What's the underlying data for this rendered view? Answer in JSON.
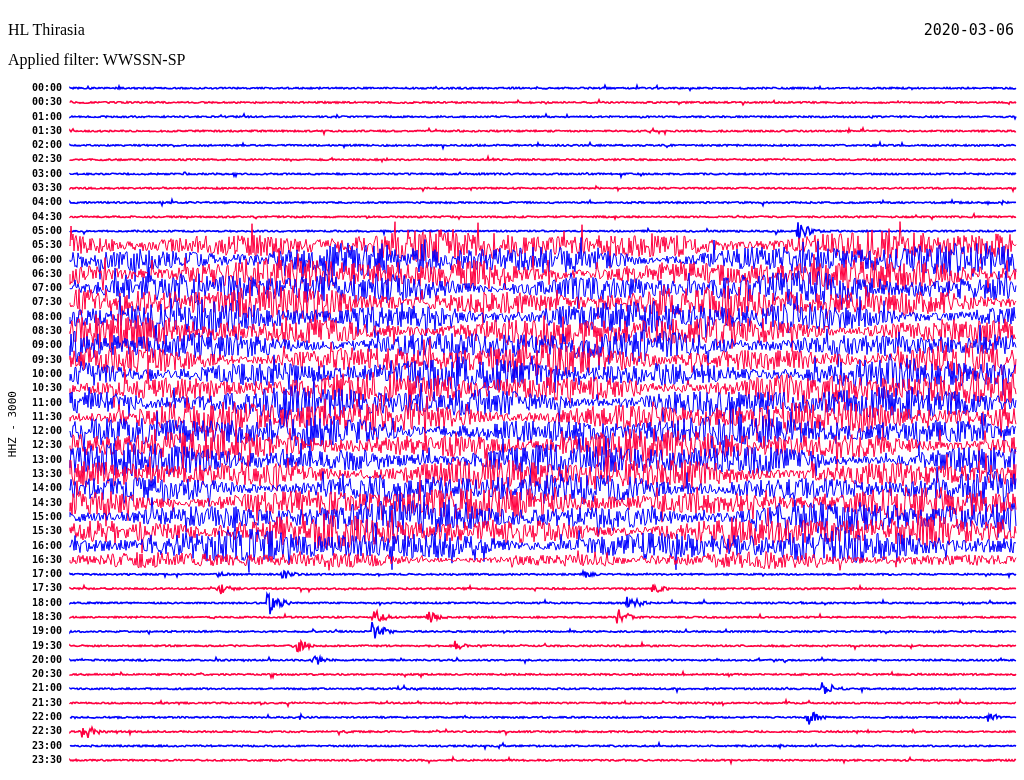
{
  "header": {
    "station": "HL Thirasia",
    "date": "2020-03-06",
    "filter": "Applied filter: WWSSN-SP"
  },
  "axis_label": "HHZ - 3000",
  "rows": [
    {
      "label": "00:00",
      "color": "#0000ff"
    },
    {
      "label": "00:30",
      "color": "#ff0040"
    },
    {
      "label": "01:00",
      "color": "#0000ff"
    },
    {
      "label": "01:30",
      "color": "#ff0040"
    },
    {
      "label": "02:00",
      "color": "#0000ff"
    },
    {
      "label": "02:30",
      "color": "#ff0040"
    },
    {
      "label": "03:00",
      "color": "#0000ff"
    },
    {
      "label": "03:30",
      "color": "#ff0040"
    },
    {
      "label": "04:00",
      "color": "#0000ff"
    },
    {
      "label": "04:30",
      "color": "#ff0040"
    },
    {
      "label": "05:00",
      "color": "#0000ff"
    },
    {
      "label": "05:30",
      "color": "#ff0040"
    },
    {
      "label": "06:00",
      "color": "#0000ff"
    },
    {
      "label": "06:30",
      "color": "#ff0040"
    },
    {
      "label": "07:00",
      "color": "#0000ff"
    },
    {
      "label": "07:30",
      "color": "#ff0040"
    },
    {
      "label": "08:00",
      "color": "#0000ff"
    },
    {
      "label": "08:30",
      "color": "#ff0040"
    },
    {
      "label": "09:00",
      "color": "#0000ff"
    },
    {
      "label": "09:30",
      "color": "#ff0040"
    },
    {
      "label": "10:00",
      "color": "#0000ff"
    },
    {
      "label": "10:30",
      "color": "#ff0040"
    },
    {
      "label": "11:00",
      "color": "#0000ff"
    },
    {
      "label": "11:30",
      "color": "#ff0040"
    },
    {
      "label": "12:00",
      "color": "#0000ff"
    },
    {
      "label": "12:30",
      "color": "#ff0040"
    },
    {
      "label": "13:00",
      "color": "#0000ff"
    },
    {
      "label": "13:30",
      "color": "#ff0040"
    },
    {
      "label": "14:00",
      "color": "#0000ff"
    },
    {
      "label": "14:30",
      "color": "#ff0040"
    },
    {
      "label": "15:00",
      "color": "#0000ff"
    },
    {
      "label": "15:30",
      "color": "#ff0040"
    },
    {
      "label": "16:00",
      "color": "#0000ff"
    },
    {
      "label": "16:30",
      "color": "#ff0040"
    },
    {
      "label": "17:00",
      "color": "#0000ff"
    },
    {
      "label": "17:30",
      "color": "#ff0040"
    },
    {
      "label": "18:00",
      "color": "#0000ff"
    },
    {
      "label": "18:30",
      "color": "#ff0040"
    },
    {
      "label": "19:00",
      "color": "#0000ff"
    },
    {
      "label": "19:30",
      "color": "#ff0040"
    },
    {
      "label": "20:00",
      "color": "#0000ff"
    },
    {
      "label": "20:30",
      "color": "#ff0040"
    },
    {
      "label": "21:00",
      "color": "#0000ff"
    },
    {
      "label": "21:30",
      "color": "#ff0040"
    },
    {
      "label": "22:00",
      "color": "#0000ff"
    },
    {
      "label": "22:30",
      "color": "#ff0040"
    },
    {
      "label": "23:00",
      "color": "#0000ff"
    },
    {
      "label": "23:30",
      "color": "#ff0040"
    }
  ]
}
